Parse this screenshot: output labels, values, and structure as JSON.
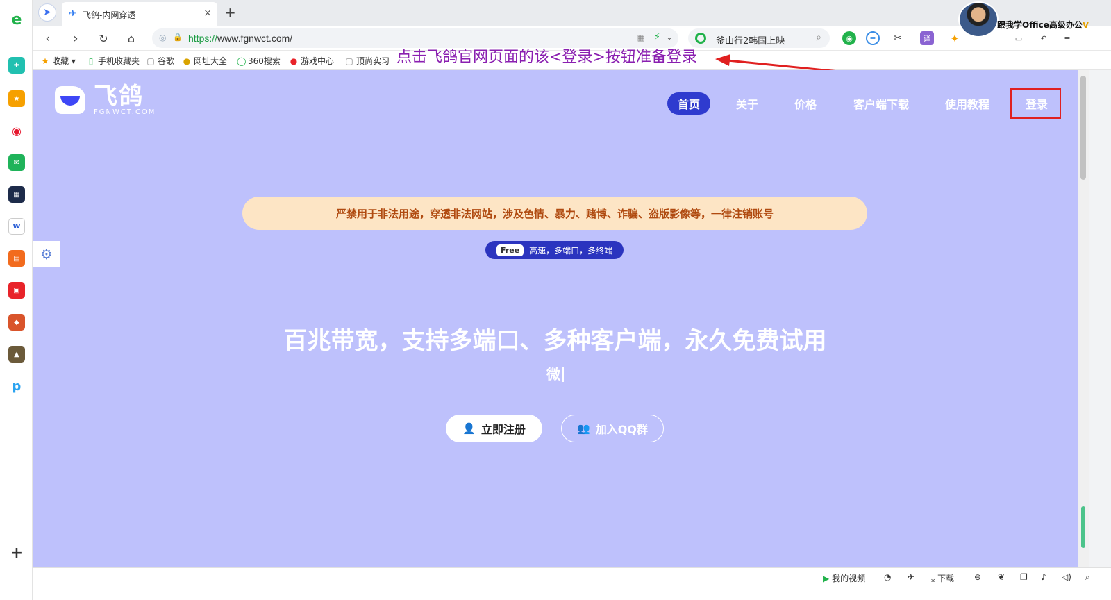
{
  "browser": {
    "tab_title": "飞鸽-内网穿透",
    "url_prefix": "https://",
    "url_rest": "www.fgnwct.com/",
    "search_text": "釜山行2韩国上映",
    "new_tab": "+",
    "tab_close": "×"
  },
  "bookmarks": [
    {
      "label": "收藏"
    },
    {
      "label": "手机收藏夹"
    },
    {
      "label": "谷歌"
    },
    {
      "label": "网址大全"
    },
    {
      "label": "360搜索"
    },
    {
      "label": "游戏中心"
    },
    {
      "label": "顶尚实习"
    }
  ],
  "annotation": {
    "text": "点击飞鸽官网页面的该<登录>按钮准备登录"
  },
  "profile": {
    "label": "跟我学Office高级办公",
    "suffix": "V"
  },
  "site": {
    "logo_cn": "飞鸽",
    "logo_en": "FGNWCT.COM",
    "nav": [
      {
        "label": "首页"
      },
      {
        "label": "关于"
      },
      {
        "label": "价格"
      },
      {
        "label": "客户端下载"
      },
      {
        "label": "使用教程"
      },
      {
        "label": "登录"
      }
    ],
    "notice": "严禁用于非法用途，穿透非法网站，涉及色情、暴力、赌博、诈骗、盗版影像等，一律注销账号",
    "pill_badge": "Free",
    "pill_text": "高速，多端口，多终端",
    "headline": "百兆带宽，支持多端口、多种客户端，永久免费试用",
    "typed": "微",
    "register_button": "立即注册",
    "qq_button": "加入QQ群"
  },
  "statusbar": {
    "my_video": "我的视频",
    "download": "下载"
  },
  "colors": {
    "page_bg": "#3e47f6",
    "notice_bg": "#fde5c5",
    "annotation": "#8a1fb0",
    "highlight_box": "#e02020"
  }
}
